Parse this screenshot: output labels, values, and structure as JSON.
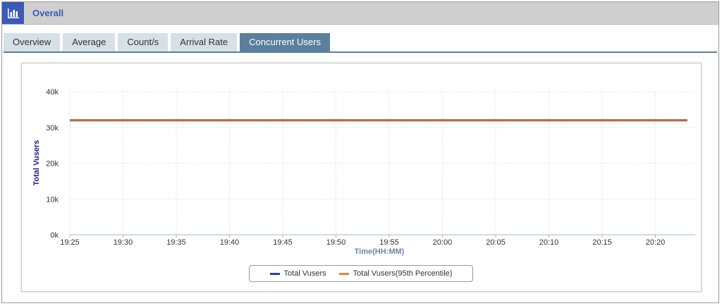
{
  "panel": {
    "title": "Overall",
    "icon": "bar-chart-icon"
  },
  "tabs": [
    {
      "label": "Overview",
      "active": false
    },
    {
      "label": "Average",
      "active": false
    },
    {
      "label": "Count/s",
      "active": false
    },
    {
      "label": "Arrival Rate",
      "active": false
    },
    {
      "label": "Concurrent Users",
      "active": true
    }
  ],
  "colors": {
    "accent": "#3b59b5",
    "tab_active": "#5b7f9c",
    "series_total": "#2a3fb0",
    "series_p95": "#e8833a",
    "plotted_line": "#c0693f"
  },
  "chart_data": {
    "type": "line",
    "xlabel": "Time(HH:MM)",
    "ylabel": "Total Vusers",
    "x_ticks": [
      "19:25",
      "19:30",
      "19:35",
      "19:40",
      "19:45",
      "19:50",
      "19:55",
      "20:00",
      "20:05",
      "20:10",
      "20:15",
      "20:20"
    ],
    "y_ticks": [
      "0k",
      "10k",
      "20k",
      "30k",
      "40k"
    ],
    "ylim": [
      0,
      40000
    ],
    "x_range": [
      "19:25",
      "20:23"
    ],
    "grid": true,
    "legend_position": "bottom",
    "series": [
      {
        "name": "Total Vusers",
        "x": [
          "19:25",
          "20:23"
        ],
        "values": [
          32000,
          32000
        ]
      },
      {
        "name": "Total Vusers(95th Percentile)",
        "x": [
          "19:25",
          "20:23"
        ],
        "values": [
          32000,
          32000
        ]
      }
    ]
  }
}
